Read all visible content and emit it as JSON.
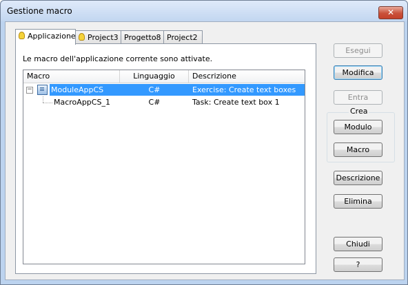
{
  "window": {
    "title": "Gestione macro",
    "close_label": "✕"
  },
  "tabs": [
    {
      "label": "Applicazione",
      "active": true,
      "icon": "lightbulb-icon"
    },
    {
      "label": "Project3",
      "active": false,
      "icon": "lightbulb-icon"
    },
    {
      "label": "Progetto8",
      "active": false
    },
    {
      "label": "Project2",
      "active": false
    }
  ],
  "panel": {
    "info_text": "Le macro dell'applicazione corrente sono attivate."
  },
  "table": {
    "columns": [
      "Macro",
      "Linguaggio",
      "Descrizione"
    ],
    "rows": [
      {
        "macro": "ModuleAppCS",
        "language": "C#",
        "description": "Exercise: Create text boxes",
        "selected": true,
        "expander": "−"
      },
      {
        "macro": "MacroAppCS_1",
        "language": "C#",
        "description": "Task: Create text box 1",
        "selected": false
      }
    ]
  },
  "buttons": {
    "esegui": "Esegui",
    "modifica": "Modifica",
    "entra": "Entra",
    "crea_group": "Crea",
    "modulo": "Modulo",
    "macro": "Macro",
    "descrizione": "Descrizione",
    "elimina": "Elimina",
    "chiudi": "Chiudi",
    "help": "?"
  },
  "colors": {
    "selection": "#3399ff",
    "title_bar": "#c2d6f0",
    "close_button": "#c9513a"
  }
}
